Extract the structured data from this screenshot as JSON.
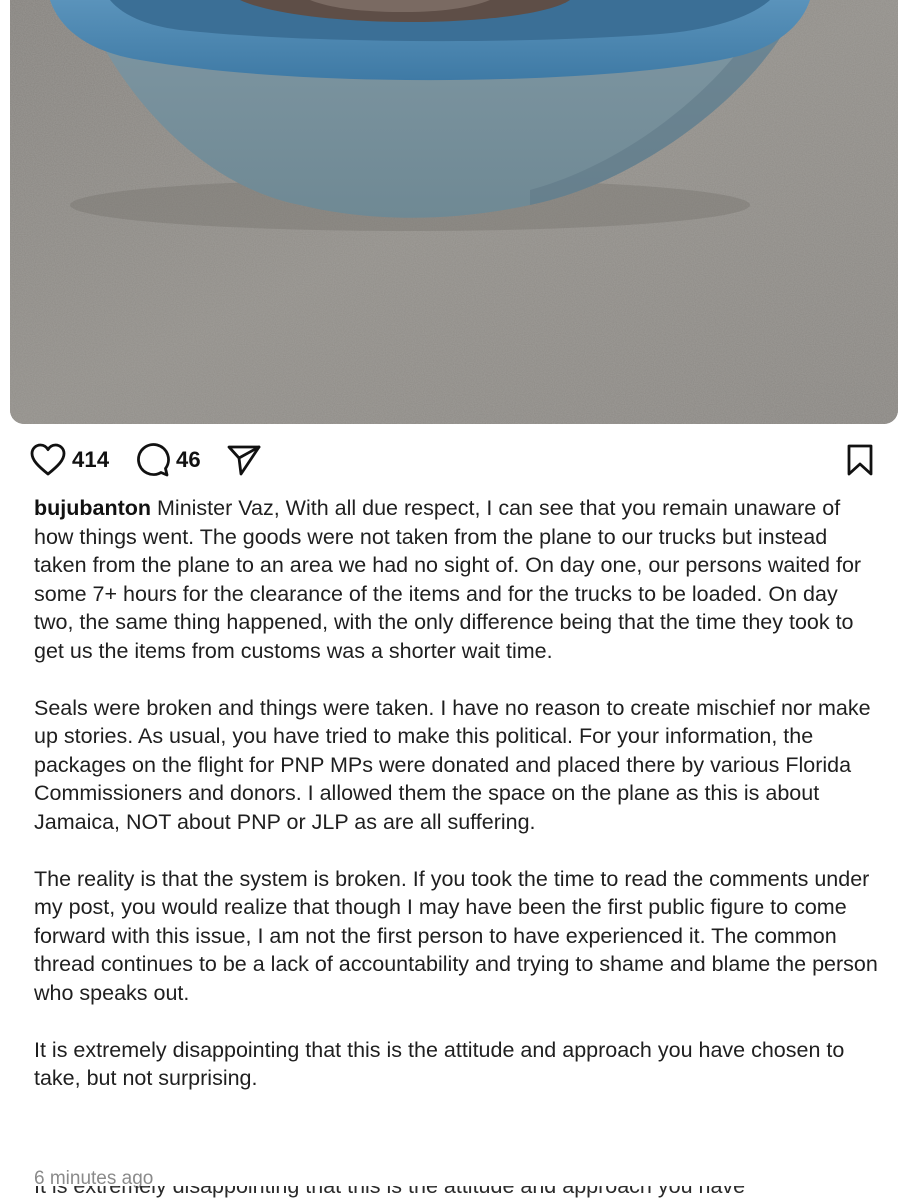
{
  "post": {
    "image": {
      "description_icon": "photo-bucket-on-pavement"
    },
    "actions": {
      "likes": "414",
      "comments": "46"
    },
    "caption": {
      "username": "bujubanton",
      "paragraph_1": "Minister Vaz, With all due respect, I can see that you remain unaware of how things went. The goods were not taken from the plane to our trucks but instead taken from the plane to an area we had no sight of. On day one, our persons waited for some 7+ hours for the clearance of the items and for the trucks to be loaded. On day two, the same thing happened, with the only difference being that the time they took to get us the items from customs was a shorter wait time.",
      "paragraph_2": "Seals were broken and things were taken. I have no reason to create mischief nor make up stories. As usual, you have tried to make this political. For your information, the packages on the flight for PNP MPs were donated and placed there by various Florida Commissioners and donors. I allowed them the space on the plane as this is about Jamaica, NOT about PNP or JLP as are all suffering.",
      "paragraph_3": "The reality is that the system is broken. If you took the time to read the comments under my post, you would realize that though I may have been the first public figure to come forward with this issue, I am not the first person to have experienced it. The common thread continues to be a lack of accountability and trying to shame and blame the person who speaks out.",
      "paragraph_4": "It is extremely disappointing that this is the attitude and approach you have chosen to take, but not surprising."
    },
    "timestamp": "6 minutes ago",
    "cutoff_text": "It is extremely disappointing that this is the attitude and approach you have"
  },
  "colors": {
    "bucket_blue": "#4f86ad",
    "pavement": "#8b8884",
    "text": "#1f1f1f",
    "muted": "#8a8a8a"
  },
  "icons": {
    "like": "heart-icon",
    "comment": "comment-bubble-icon",
    "share": "paper-plane-icon",
    "save": "bookmark-icon"
  }
}
